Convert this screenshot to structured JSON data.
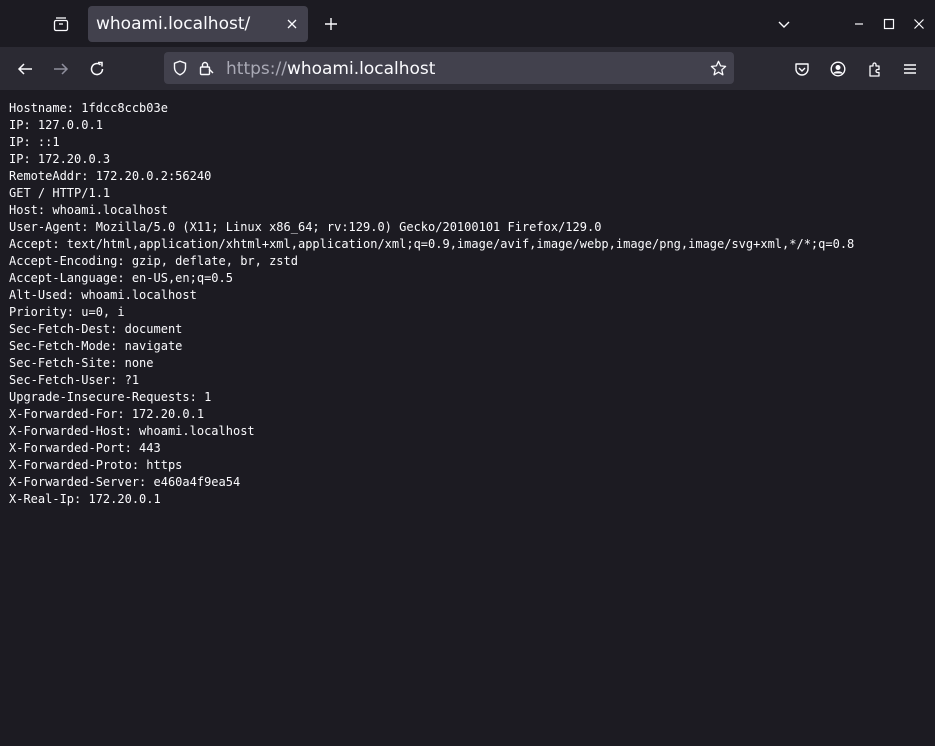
{
  "tab": {
    "title": "whoami.localhost/"
  },
  "url": {
    "scheme": "https://",
    "host": "whoami.localhost"
  },
  "icons": {
    "tab_list": "tab-list-icon",
    "tab_close": "close-icon",
    "new_tab": "plus-icon",
    "tabs_dropdown": "chevron-down-icon",
    "minimize": "minimize-icon",
    "maximize": "maximize-icon",
    "close_window": "close-icon",
    "back": "arrow-left-icon",
    "forward": "arrow-right-icon",
    "reload": "reload-icon",
    "tracking_protection": "shield-icon",
    "lock": "lock-icon",
    "bookmark": "star-icon",
    "pocket": "pocket-icon",
    "account": "account-icon",
    "extensions": "puzzle-icon",
    "menu": "hamburger-menu-icon"
  },
  "colors": {
    "background": "#1c1b22",
    "toolbar": "#2b2a33",
    "tab_active": "#42414d",
    "text": "#fbfbfe",
    "muted": "#a9a9b5"
  },
  "response_lines": [
    "Hostname: 1fdcc8ccb03e",
    "IP: 127.0.0.1",
    "IP: ::1",
    "IP: 172.20.0.3",
    "RemoteAddr: 172.20.0.2:56240",
    "GET / HTTP/1.1",
    "Host: whoami.localhost",
    "User-Agent: Mozilla/5.0 (X11; Linux x86_64; rv:129.0) Gecko/20100101 Firefox/129.0",
    "Accept: text/html,application/xhtml+xml,application/xml;q=0.9,image/avif,image/webp,image/png,image/svg+xml,*/*;q=0.8",
    "Accept-Encoding: gzip, deflate, br, zstd",
    "Accept-Language: en-US,en;q=0.5",
    "Alt-Used: whoami.localhost",
    "Priority: u=0, i",
    "Sec-Fetch-Dest: document",
    "Sec-Fetch-Mode: navigate",
    "Sec-Fetch-Site: none",
    "Sec-Fetch-User: ?1",
    "Upgrade-Insecure-Requests: 1",
    "X-Forwarded-For: 172.20.0.1",
    "X-Forwarded-Host: whoami.localhost",
    "X-Forwarded-Port: 443",
    "X-Forwarded-Proto: https",
    "X-Forwarded-Server: e460a4f9ea54",
    "X-Real-Ip: 172.20.0.1"
  ]
}
